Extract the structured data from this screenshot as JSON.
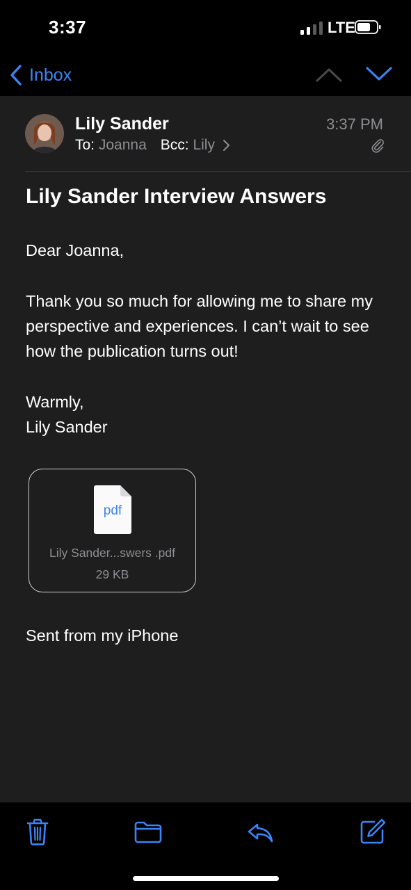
{
  "status_bar": {
    "time": "3:37",
    "network": "LTE",
    "icons": [
      "signal-icon",
      "battery-icon"
    ]
  },
  "nav": {
    "back_label": "Inbox",
    "icons": [
      "chevron-left-icon",
      "chevron-up-icon",
      "chevron-down-icon"
    ]
  },
  "message": {
    "sender": "Lily Sander",
    "to_label": "To:",
    "to": "Joanna",
    "bcc_label": "Bcc:",
    "bcc": "Lily",
    "time": "3:37 PM",
    "subject": "Lily Sander Interview Answers",
    "greeting": "Dear Joanna,",
    "body": "Thank you so much for allowing me to share my perspective and experiences. I can’t wait to see how the publication turns out!",
    "closing": "Warmly,",
    "closing_name": "Lily Sander",
    "signature": "Sent from my iPhone",
    "attachment": {
      "icon_label": "pdf",
      "name": "Lily Sander...swers .pdf",
      "size": "29 KB"
    }
  },
  "toolbar": {
    "icons": [
      "trash-icon",
      "folder-icon",
      "reply-icon",
      "compose-icon"
    ]
  },
  "colors": {
    "accent": "#3a84f7",
    "background": "#1e1e1e",
    "bars": "#000000",
    "secondary_text": "#8e8e93"
  }
}
